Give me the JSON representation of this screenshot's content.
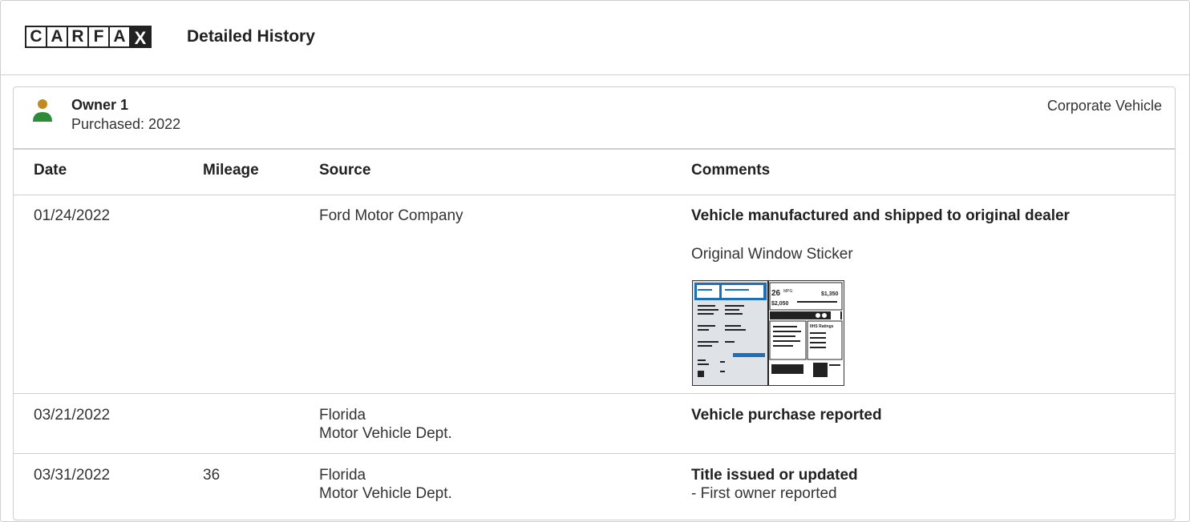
{
  "header": {
    "logo_letters": [
      "C",
      "A",
      "R",
      "F",
      "A",
      "X"
    ],
    "title": "Detailed History"
  },
  "owner": {
    "name": "Owner 1",
    "purchased": "Purchased: 2022",
    "type": "Corporate Vehicle",
    "icon": "person-icon"
  },
  "table": {
    "columns": [
      "Date",
      "Mileage",
      "Source",
      "Comments"
    ],
    "rows": [
      {
        "date": "01/24/2022",
        "mileage": "",
        "source": [
          "Ford Motor Company"
        ],
        "comment_title": "Vehicle manufactured and shipped to original dealer",
        "comment_link": "Original Window Sticker",
        "sticker": {
          "mpg": "26",
          "mpg_unit": "MPG",
          "save": "$1,350",
          "fuel_cost": "$2,050",
          "ratings_label": "IIHS Ratings"
        }
      },
      {
        "date": "03/21/2022",
        "mileage": "",
        "source": [
          "Florida",
          "Motor Vehicle Dept."
        ],
        "comment_title": "Vehicle purchase reported"
      },
      {
        "date": "03/31/2022",
        "mileage": "36",
        "source": [
          "Florida",
          "Motor Vehicle Dept."
        ],
        "comment_title": "Title issued or updated",
        "comment_detail": "- First owner reported"
      }
    ]
  },
  "colors": {
    "owner_head": "#c08a1e",
    "owner_body": "#2e8b3a",
    "border": "#cfcfcf"
  }
}
